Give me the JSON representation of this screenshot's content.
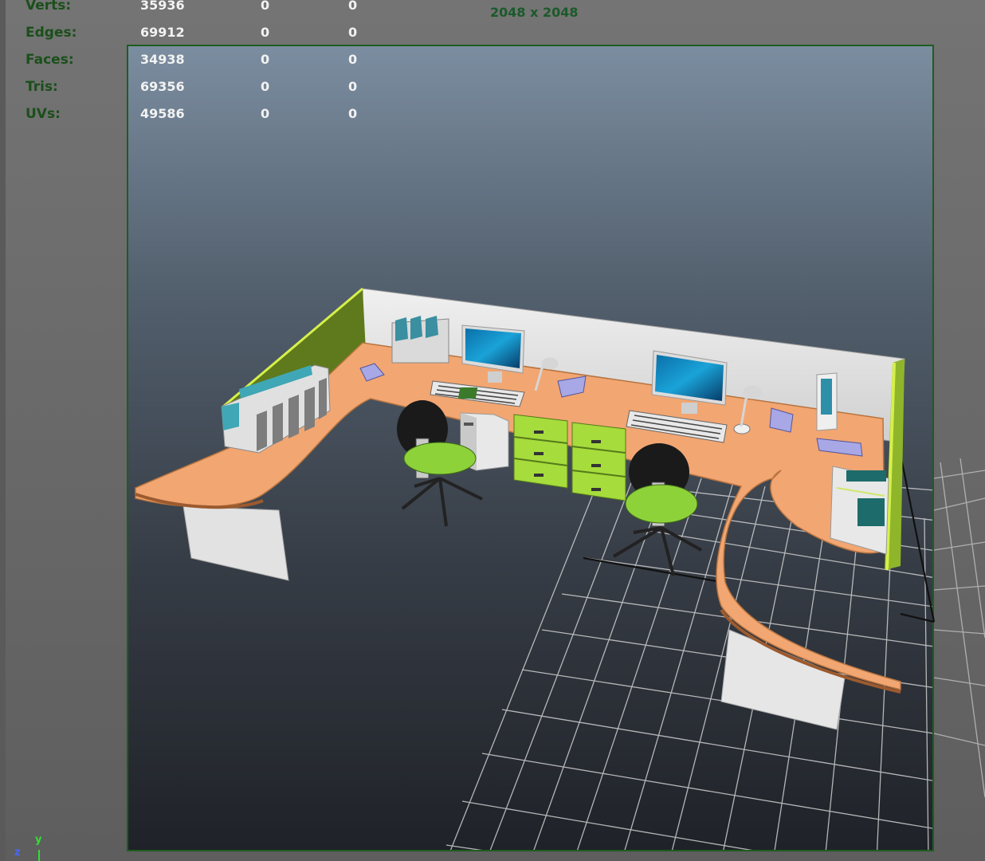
{
  "heads_up": {
    "rows": [
      {
        "label": "Verts:",
        "values": [
          "35936",
          "0",
          "0"
        ]
      },
      {
        "label": "Edges:",
        "values": [
          "69912",
          "0",
          "0"
        ]
      },
      {
        "label": "Faces:",
        "values": [
          "34938",
          "0",
          "0"
        ]
      },
      {
        "label": "Tris:",
        "values": [
          "69356",
          "0",
          "0"
        ]
      },
      {
        "label": "UVs:",
        "values": [
          "49586",
          "0",
          "0"
        ]
      }
    ],
    "resolution": "2048 x 2048"
  },
  "axis": {
    "y": "y",
    "z": "z"
  },
  "icons": [
    "view-axis-icon"
  ],
  "colors": {
    "hud_label": "#1b4f1b",
    "hud_value": "#f2f2f2",
    "gate_border": "#1f5c1f",
    "desk_top": "#f2a672",
    "panel_green": "#a6dc3c",
    "grid": "#cfcfcf"
  }
}
